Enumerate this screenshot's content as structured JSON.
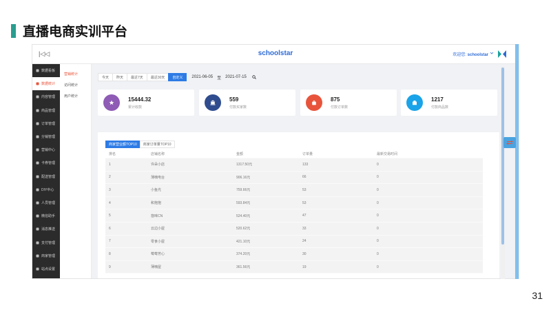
{
  "slide": {
    "title": "直播电商实训平台",
    "page_number": "31"
  },
  "topbar": {
    "collapse_glyph": "|◁◁",
    "brand": "schoolstar",
    "welcome_prefix": "欢迎您:",
    "username": "schoolstar"
  },
  "sidebar": {
    "items": [
      {
        "label": "数据看板",
        "icon": "dashboard-icon"
      },
      {
        "label": "数据统计",
        "icon": "chart-icon",
        "active": true
      },
      {
        "label": "内容管理",
        "icon": "content-icon"
      },
      {
        "label": "商品管理",
        "icon": "goods-icon"
      },
      {
        "label": "订单管理",
        "icon": "order-icon"
      },
      {
        "label": "分销管理",
        "icon": "share-icon"
      },
      {
        "label": "营销中心",
        "icon": "marketing-icon"
      },
      {
        "label": "卡券管理",
        "icon": "card-icon"
      },
      {
        "label": "配送管理",
        "icon": "delivery-icon"
      },
      {
        "label": "DIY中心",
        "icon": "diy-icon"
      },
      {
        "label": "人员管理",
        "icon": "people-icon"
      },
      {
        "label": "微信助手",
        "icon": "wechat-icon"
      },
      {
        "label": "消息推送",
        "icon": "message-icon"
      },
      {
        "label": "支付管理",
        "icon": "pay-icon"
      },
      {
        "label": "商家管理",
        "icon": "shop-icon"
      },
      {
        "label": "站点设置",
        "icon": "settings-icon"
      }
    ]
  },
  "submenu": {
    "items": [
      {
        "label": "营销统计",
        "active": true
      },
      {
        "label": "访问统计"
      },
      {
        "label": "用户统计"
      }
    ]
  },
  "filter": {
    "tabs": [
      {
        "label": "今天"
      },
      {
        "label": "昨天"
      },
      {
        "label": "最近7天"
      },
      {
        "label": "最近30天"
      },
      {
        "label": "自定义",
        "active": true
      }
    ],
    "start_date": "2021-06-05",
    "separator": "至",
    "end_date": "2021-07-15"
  },
  "stats": [
    {
      "value": "15444.32",
      "label": "累计收款",
      "color": "#8e5bb5",
      "icon": "star-icon"
    },
    {
      "value": "559",
      "label": "付款买家数",
      "color": "#2f4d8e",
      "icon": "bank-icon"
    },
    {
      "value": "875",
      "label": "付款订单数",
      "color": "#e8543b",
      "icon": "bag-icon"
    },
    {
      "value": "1217",
      "label": "付款商品数",
      "color": "#1aa3e8",
      "icon": "box-icon"
    }
  ],
  "ranking": {
    "tabs": [
      {
        "label": "商家营业额TOP10",
        "active": true
      },
      {
        "label": "商家订单量TOP10"
      }
    ],
    "columns": [
      "排名",
      "店铺名称",
      "金额",
      "订单量",
      "最新交易时间"
    ],
    "rows": [
      [
        "1",
        "许朵小店",
        "1317.50元",
        "133",
        "0"
      ],
      [
        "2",
        "薄楠电台",
        "906.16元",
        "66",
        "0"
      ],
      [
        "3",
        "小鱼光",
        "759.66元",
        "53",
        "0"
      ],
      [
        "4",
        "和抱抱",
        "593.84元",
        "53",
        "0"
      ],
      [
        "5",
        "悠味CN",
        "524.40元",
        "47",
        "0"
      ],
      [
        "6",
        "云边小屋",
        "520.62元",
        "33",
        "0"
      ],
      [
        "7",
        "零食小屋",
        "421.10元",
        "24",
        "0"
      ],
      [
        "8",
        "莓莓芳心",
        "374.20元",
        "30",
        "0"
      ],
      [
        "9",
        "薄楠屋",
        "361.56元",
        "19",
        "0"
      ]
    ]
  },
  "colors": {
    "accent": "#2d7be5",
    "active_red": "#e8543b",
    "slide_bar": "#2a9d8f"
  }
}
